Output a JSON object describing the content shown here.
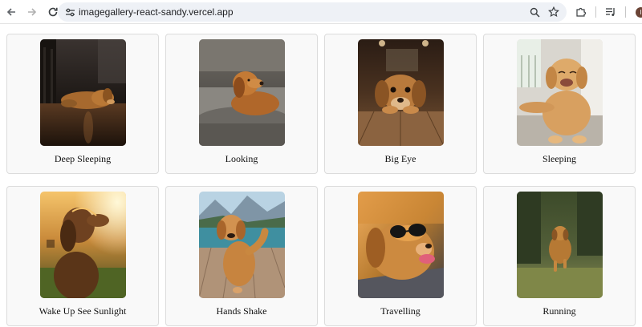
{
  "browser": {
    "url": "imagegallery-react-sandy.vercel.app",
    "profile_initial": "I",
    "icons": {
      "back": "arrow-left-icon",
      "forward": "arrow-right-icon",
      "reload": "reload-icon",
      "site_info": "tune-icon",
      "zoom": "search-icon",
      "bookmark": "star-icon",
      "extensions": "puzzle-icon",
      "media": "media-queue-icon",
      "menu": "kebab-menu-icon"
    }
  },
  "gallery": {
    "items": [
      {
        "caption": "Deep Sleeping"
      },
      {
        "caption": "Looking"
      },
      {
        "caption": "Big Eye"
      },
      {
        "caption": "Sleeping"
      },
      {
        "caption": "Wake Up See Sunlight"
      },
      {
        "caption": "Hands Shake"
      },
      {
        "caption": "Travelling"
      },
      {
        "caption": "Running"
      }
    ]
  },
  "colors": {
    "card_bg": "#f9f9f9",
    "card_border": "#dcdcdc",
    "omnibox_bg": "#eef1f6",
    "avatar_bg": "#6b4436"
  }
}
